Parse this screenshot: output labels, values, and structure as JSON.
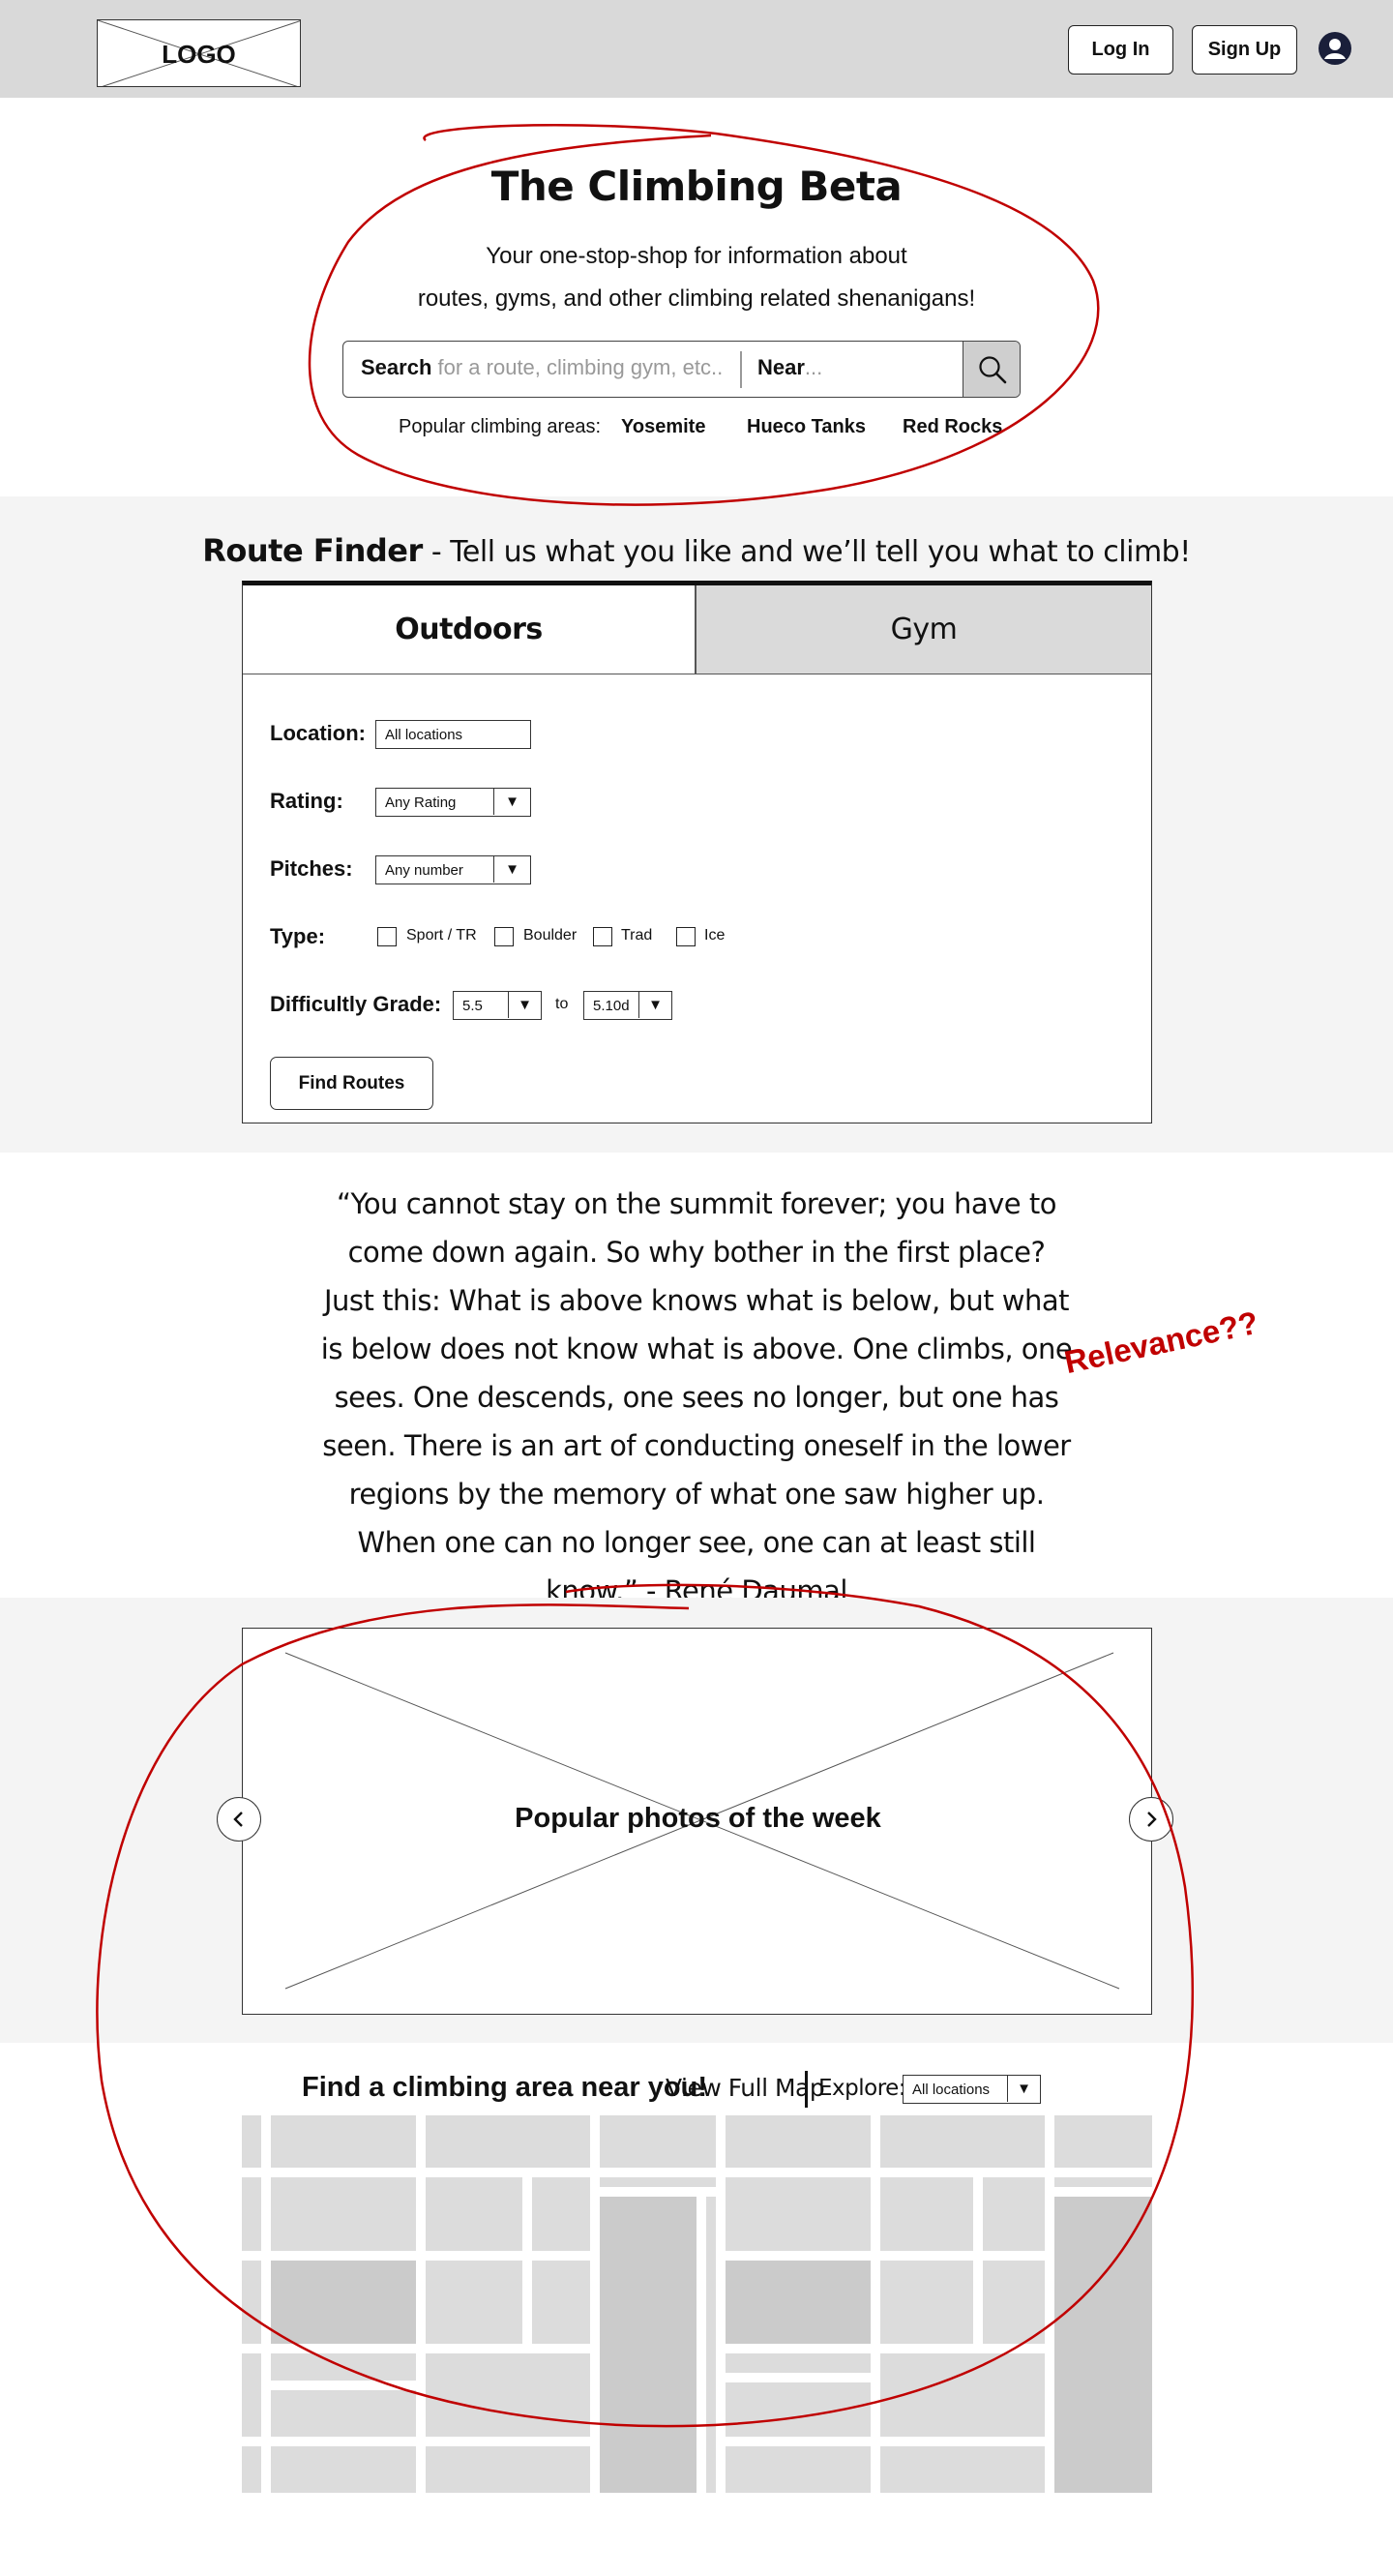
{
  "header": {
    "logo_text": "LOGO",
    "login_label": "Log In",
    "signup_label": "Sign Up",
    "avatar_icon": "user-circle-icon"
  },
  "hero": {
    "title": "The Climbing Beta",
    "subtitle_line1": "Your one-stop-shop for information about",
    "subtitle_line2": "routes, gyms, and other climbing related shenanigans!",
    "search_label": "Search",
    "search_placeholder": "for a route, climbing gym, etc..",
    "near_label": "Near",
    "near_placeholder": "...",
    "search_icon": "search-icon",
    "popular_label": "Popular climbing areas:",
    "popular_areas": [
      "Yosemite",
      "Hueco Tanks",
      "Red Rocks"
    ]
  },
  "route_finder": {
    "title": "Route Finder",
    "tagline": "- Tell us what you like and we’ll tell you what to climb!",
    "tabs": [
      "Outdoors",
      "Gym"
    ],
    "active_tab": "Outdoors",
    "location_label": "Location:",
    "location_value": "All locations",
    "rating_label": "Rating:",
    "rating_value": "Any Rating",
    "pitches_label": "Pitches:",
    "pitches_value": "Any number",
    "type_label": "Type:",
    "types": [
      "Sport / TR",
      "Boulder",
      "Trad",
      "Ice"
    ],
    "grade_label": "Difficultly Grade:",
    "grade_from": "5.5",
    "grade_to_label": "to",
    "grade_to": "5.10d",
    "find_button": "Find Routes",
    "dropdown_arrow": "▼"
  },
  "quote": {
    "text": "“You cannot stay on the summit forever; you have to come down again. So why bother in the first place? Just this: What is above knows what is below, but what is below does not know what is above. One climbs, one sees. One descends, one sees no longer, but one has seen. There is an art of conducting oneself in the lower regions by the memory of what one saw higher up. When one can no longer see, one can at least still know.” - René Daumal"
  },
  "annotation": {
    "note": "Relevance??",
    "color": "#c00000"
  },
  "photos": {
    "title": "Popular photos of the week",
    "prev_icon": "chevron-left-icon",
    "next_icon": "chevron-right-icon"
  },
  "map": {
    "heading": "Find a climbing area near you!",
    "full_map_link": "View Full Map",
    "explore_label": "Explore:",
    "explore_value": "All locations"
  }
}
